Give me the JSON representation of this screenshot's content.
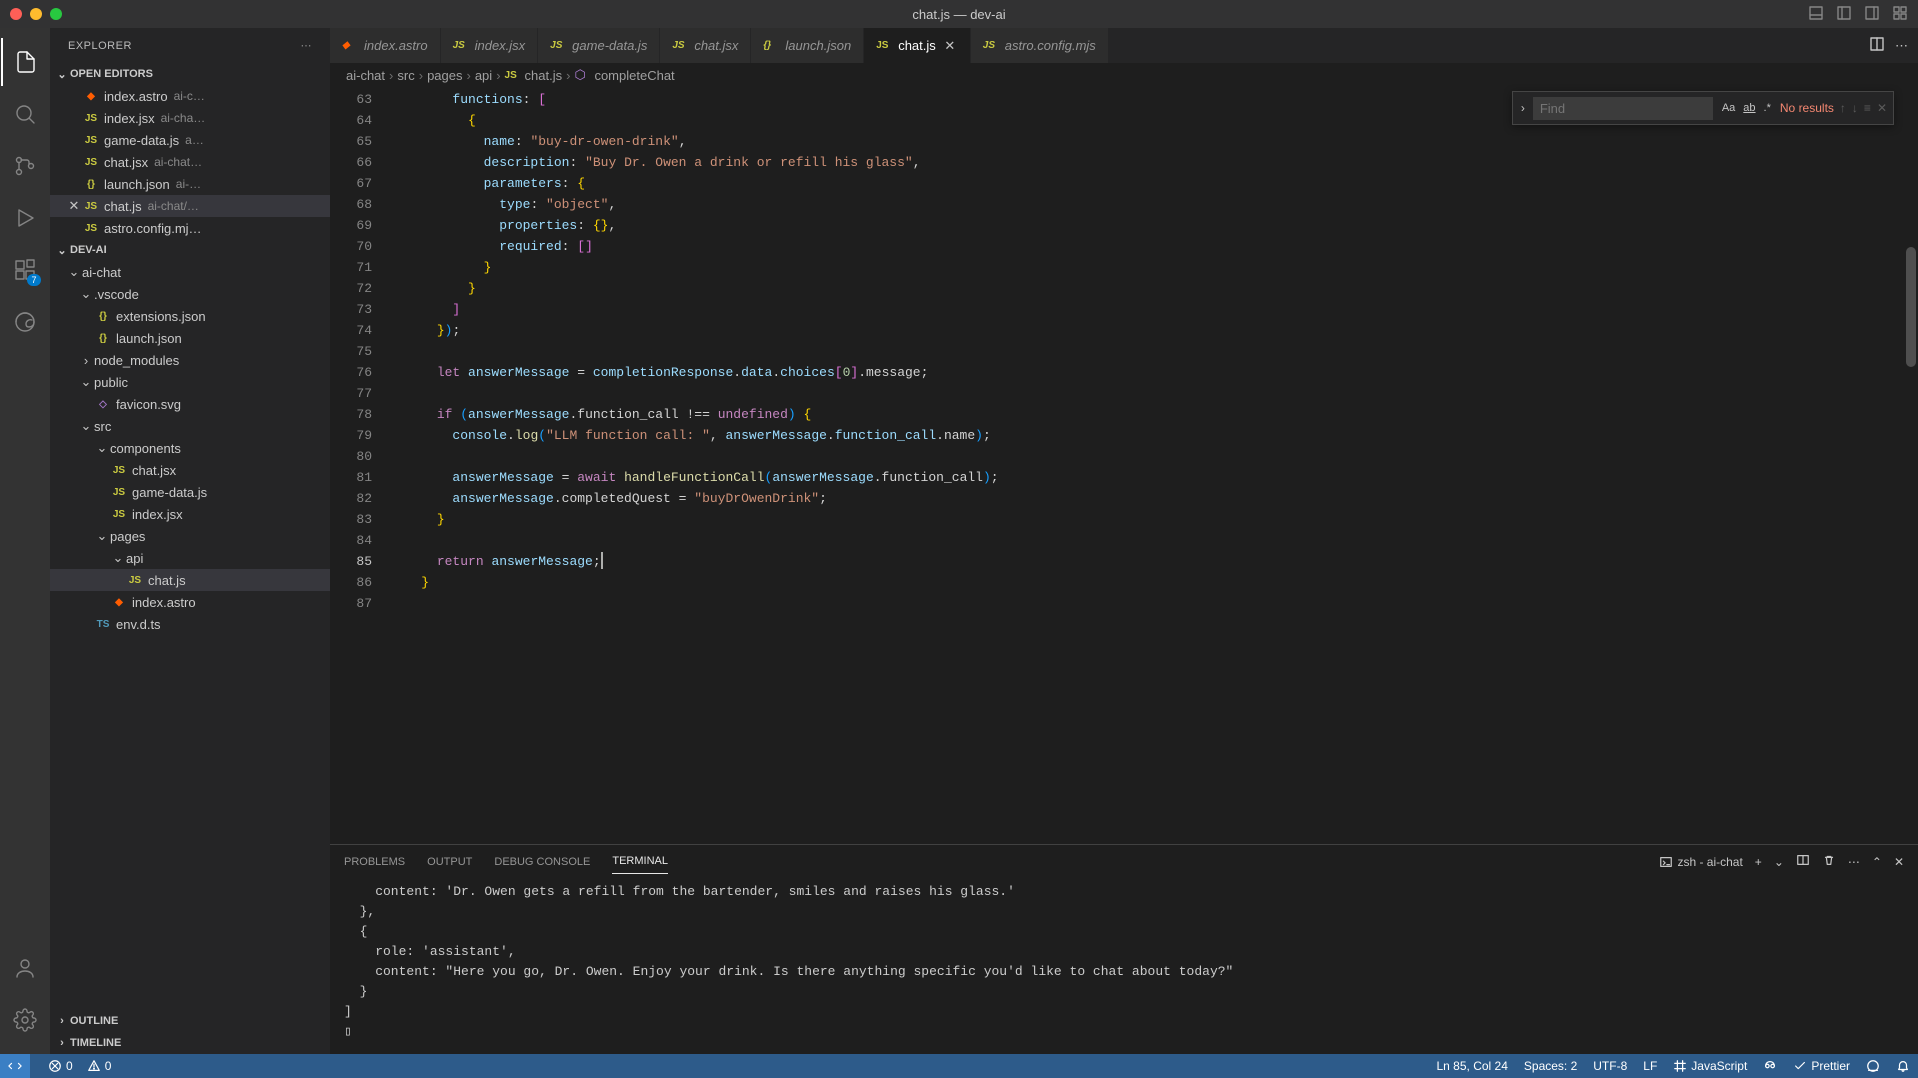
{
  "window": {
    "title": "chat.js — dev-ai"
  },
  "activitybar": {
    "badge": "7"
  },
  "sidebar": {
    "title": "EXPLORER",
    "openEditorsLabel": "OPEN EDITORS",
    "openEditors": [
      {
        "name": "index.astro",
        "desc": "ai-c…",
        "icon": "astro"
      },
      {
        "name": "index.jsx",
        "desc": "ai-cha…",
        "icon": "js"
      },
      {
        "name": "game-data.js",
        "desc": "a…",
        "icon": "js"
      },
      {
        "name": "chat.jsx",
        "desc": "ai-chat…",
        "icon": "js"
      },
      {
        "name": "launch.json",
        "desc": "ai-…",
        "icon": "json"
      },
      {
        "name": "chat.js",
        "desc": "ai-chat/…",
        "icon": "js",
        "active": true
      },
      {
        "name": "astro.config.mj…",
        "desc": "",
        "icon": "js"
      }
    ],
    "projectLabel": "DEV-AI",
    "tree": [
      {
        "name": "ai-chat",
        "indent": 1,
        "type": "folder",
        "open": true
      },
      {
        "name": ".vscode",
        "indent": 2,
        "type": "folder",
        "open": true
      },
      {
        "name": "extensions.json",
        "indent": 3,
        "type": "file",
        "icon": "json"
      },
      {
        "name": "launch.json",
        "indent": 3,
        "type": "file",
        "icon": "json"
      },
      {
        "name": "node_modules",
        "indent": 2,
        "type": "folder",
        "open": false
      },
      {
        "name": "public",
        "indent": 2,
        "type": "folder",
        "open": true
      },
      {
        "name": "favicon.svg",
        "indent": 3,
        "type": "file",
        "icon": "svg"
      },
      {
        "name": "src",
        "indent": 2,
        "type": "folder",
        "open": true
      },
      {
        "name": "components",
        "indent": 3,
        "type": "folder",
        "open": true
      },
      {
        "name": "chat.jsx",
        "indent": 4,
        "type": "file",
        "icon": "js"
      },
      {
        "name": "game-data.js",
        "indent": 4,
        "type": "file",
        "icon": "js"
      },
      {
        "name": "index.jsx",
        "indent": 4,
        "type": "file",
        "icon": "js"
      },
      {
        "name": "pages",
        "indent": 3,
        "type": "folder",
        "open": true
      },
      {
        "name": "api",
        "indent": 4,
        "type": "folder",
        "open": true
      },
      {
        "name": "chat.js",
        "indent": 5,
        "type": "file",
        "icon": "js",
        "active": true
      },
      {
        "name": "index.astro",
        "indent": 4,
        "type": "file",
        "icon": "astro"
      },
      {
        "name": "env.d.ts",
        "indent": 3,
        "type": "file",
        "icon": "ts"
      }
    ],
    "outlineLabel": "OUTLINE",
    "timelineLabel": "TIMELINE"
  },
  "tabs": [
    {
      "name": "index.astro",
      "icon": "astro",
      "italic": true
    },
    {
      "name": "index.jsx",
      "icon": "js",
      "italic": true
    },
    {
      "name": "game-data.js",
      "icon": "js",
      "italic": true
    },
    {
      "name": "chat.jsx",
      "icon": "js",
      "italic": true
    },
    {
      "name": "launch.json",
      "icon": "json",
      "italic": true
    },
    {
      "name": "chat.js",
      "icon": "js",
      "active": true
    },
    {
      "name": "astro.config.mjs",
      "icon": "js",
      "italic": true
    }
  ],
  "breadcrumb": [
    "ai-chat",
    "src",
    "pages",
    "api",
    "chat.js",
    "completeChat"
  ],
  "find": {
    "placeholder": "Find",
    "results": "No results"
  },
  "code": {
    "startLine": 63,
    "currentLine": 85,
    "lines": [
      "        functions: [",
      "          {",
      "            name: \"buy-dr-owen-drink\",",
      "            description: \"Buy Dr. Owen a drink or refill his glass\",",
      "            parameters: {",
      "              type: \"object\",",
      "              properties: {},",
      "              required: []",
      "            }",
      "          }",
      "        ]",
      "      });",
      "",
      "      let answerMessage = completionResponse.data.choices[0].message;",
      "",
      "      if (answerMessage.function_call !== undefined) {",
      "        console.log(\"LLM function call: \", answerMessage.function_call.name);",
      "",
      "        answerMessage = await handleFunctionCall(answerMessage.function_call);",
      "        answerMessage.completedQuest = \"buyDrOwenDrink\";",
      "      }",
      "",
      "      return answerMessage;",
      "    }",
      ""
    ]
  },
  "panel": {
    "tabs": [
      "PROBLEMS",
      "OUTPUT",
      "DEBUG CONSOLE",
      "TERMINAL"
    ],
    "activeTab": 3,
    "shell": "zsh - ai-chat",
    "output": "    content: 'Dr. Owen gets a refill from the bartender, smiles and raises his glass.'\n  },\n  {\n    role: 'assistant',\n    content: \"Here you go, Dr. Owen. Enjoy your drink. Is there anything specific you'd like to chat about today?\"\n  }\n]\n▯"
  },
  "status": {
    "errors": "0",
    "warnings": "0",
    "position": "Ln 85, Col 24",
    "spaces": "Spaces: 2",
    "encoding": "UTF-8",
    "eol": "LF",
    "language": "JavaScript",
    "prettier": "Prettier"
  }
}
